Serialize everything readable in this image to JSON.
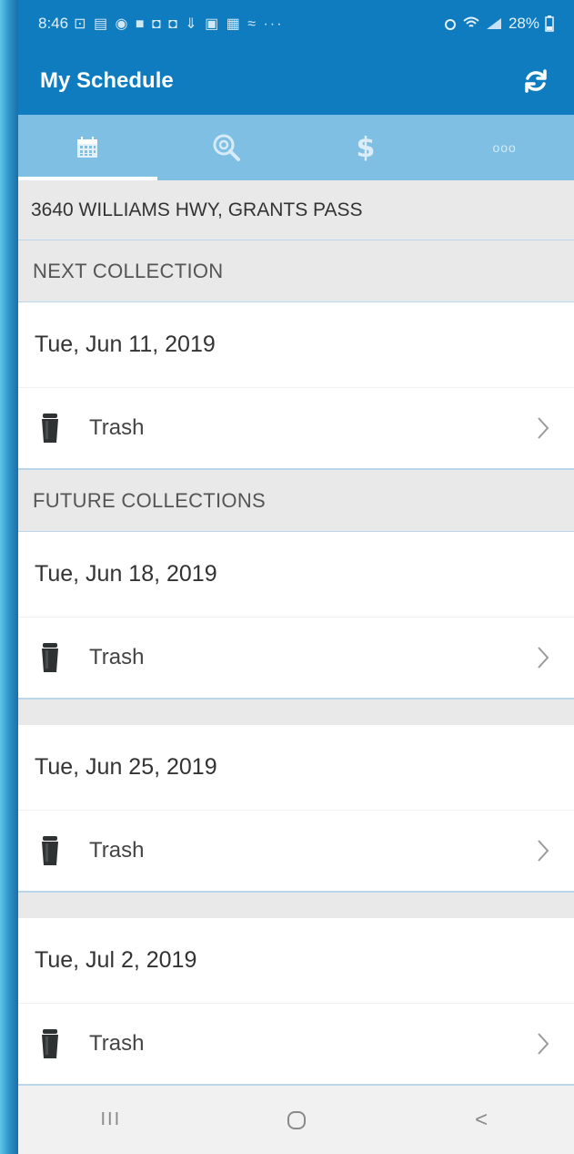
{
  "status_bar": {
    "time": "8:46",
    "notification_icons": "⊡ ▤ ◉ ■ ◘ ◘ ⇓ ▣ ▦ ≈ ···",
    "battery": "28%"
  },
  "app_bar": {
    "title": "My Schedule",
    "refresh_icon": "refresh-icon"
  },
  "tabs": [
    {
      "name": "calendar",
      "icon": "calendar-icon",
      "active": true
    },
    {
      "name": "search",
      "icon": "search-icon",
      "active": false
    },
    {
      "name": "billing",
      "icon": "dollar-icon",
      "label": "$",
      "active": false
    },
    {
      "name": "more",
      "icon": "more-icon",
      "label": "ooo",
      "active": false
    }
  ],
  "address": "3640 WILLIAMS HWY, GRANTS PASS",
  "next_collection": {
    "header": "NEXT COLLECTION",
    "items": [
      {
        "date": "Tue, Jun 11, 2019",
        "type": "Trash"
      }
    ]
  },
  "future_collections": {
    "header": "FUTURE COLLECTIONS",
    "items": [
      {
        "date": "Tue, Jun 18, 2019",
        "type": "Trash"
      },
      {
        "date": "Tue, Jun 25, 2019",
        "type": "Trash"
      },
      {
        "date": "Tue, Jul 2, 2019",
        "type": "Trash"
      }
    ]
  },
  "nav_bar": {
    "recents": "III",
    "home_icon": "home-icon",
    "back": "<"
  },
  "colors": {
    "primary": "#0e7cbf",
    "tab_bar": "#7fbfe4",
    "background": "#e9e9e9"
  }
}
